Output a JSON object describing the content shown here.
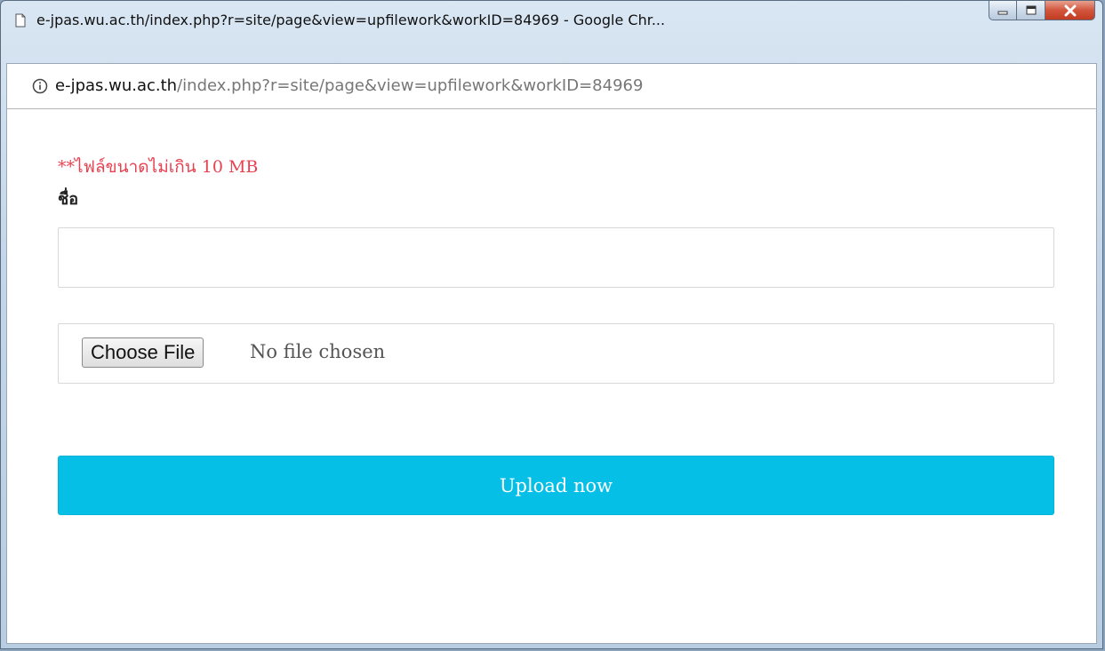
{
  "window": {
    "title": "e-jpas.wu.ac.th/index.php?r=site/page&view=upfilework&workID=84969 - Google Chr...",
    "controls": {
      "minimize_icon": "minimize-icon",
      "maximize_icon": "maximize-icon",
      "close_icon": "close-icon"
    }
  },
  "address": {
    "host": "e-jpas.wu.ac.th",
    "path": "/index.php?r=site/page&view=upfilework&workID=84969"
  },
  "form": {
    "note": "**ไฟล์ขนาดไม่เกิน 10 MB",
    "name_label": "ชื่อ",
    "name_value": "",
    "choose_file_label": "Choose File",
    "no_file_text": "No file chosen",
    "upload_label": "Upload now"
  },
  "colors": {
    "note": "#e84151",
    "upload_button": "#06bfe6"
  }
}
